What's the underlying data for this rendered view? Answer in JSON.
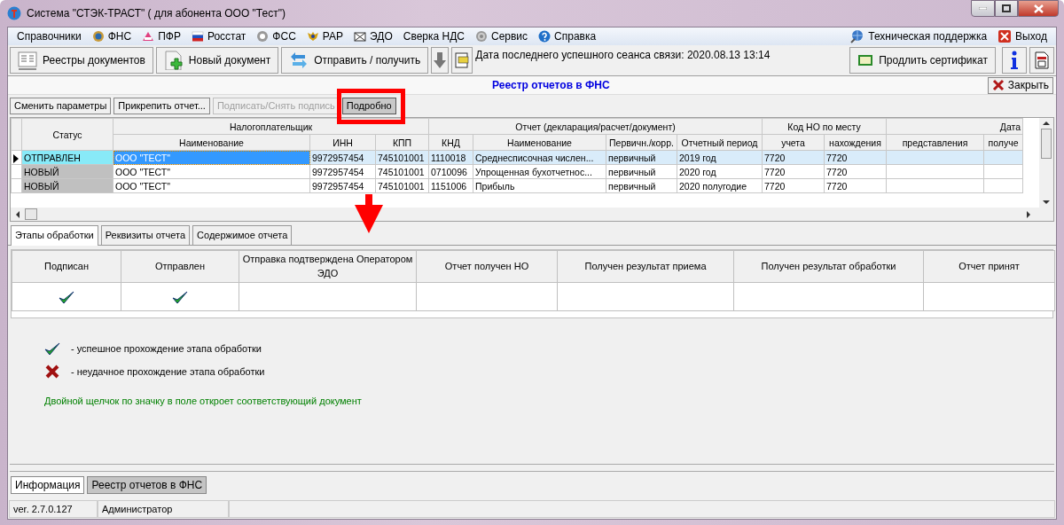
{
  "window": {
    "title": "Система \"СТЭК-ТРАСТ\" ( для абонента ООО \"Тест\")"
  },
  "menu": {
    "left": [
      "Справочники",
      "ФНС",
      "ПФР",
      "Росстат",
      "ФСС",
      "РАР",
      "ЭДО",
      "Сверка НДС",
      "Сервис",
      "Справка"
    ],
    "right": [
      "Техническая поддержка",
      "Выход"
    ]
  },
  "toolbar": {
    "buttons": [
      "Реестры документов",
      "Новый документ",
      "Отправить / получить"
    ],
    "last_session": "Дата последнего успешного сеанса связи: 2020.08.13 13:14",
    "renew_button": "Продлить сертификат"
  },
  "panel": {
    "title": "Реестр отчетов в ФНС",
    "close_button": "Закрыть"
  },
  "actions": [
    {
      "label": "Сменить параметры",
      "disabled": false,
      "pressed": false
    },
    {
      "label": "Прикрепить отчет...",
      "disabled": false,
      "pressed": false
    },
    {
      "label": "Подписать/Снять подпись",
      "disabled": true,
      "pressed": false
    },
    {
      "label": "Подробно",
      "disabled": false,
      "pressed": true
    }
  ],
  "report_grid": {
    "status_column": "Статус",
    "column_groups": [
      {
        "label": "Налогоплательщик",
        "columns": [
          "Наименование",
          "ИНН",
          "КПП"
        ]
      },
      {
        "label": "Отчет (декларация/расчет/документ)",
        "columns": [
          "КНД",
          "Наименование",
          "Первичн./корр.",
          "Отчетный период"
        ]
      },
      {
        "label": "Код НО по месту",
        "columns": [
          "учета",
          "нахождения"
        ]
      },
      {
        "label": "Дата",
        "columns": [
          "представления",
          "получе"
        ]
      }
    ],
    "rows": [
      {
        "selected": true,
        "status": "ОТПРАВЛЕН",
        "color": "#88eaf8",
        "cells": [
          "ООО \"ТЕСТ\"",
          "9972957454",
          "745101001",
          "1110018",
          "Среднесписочная числен...",
          "первичный",
          "2019 год",
          "7720",
          "7720"
        ]
      },
      {
        "selected": false,
        "status": "НОВЫЙ",
        "color": "#c0c0c0",
        "cells": [
          "ООО \"ТЕСТ\"",
          "9972957454",
          "745101001",
          "0710096",
          "Упрощенная бухотчетнос...",
          "первичный",
          "2020 год",
          "7720",
          "7720"
        ]
      },
      {
        "selected": false,
        "status": "НОВЫЙ",
        "color": "#c0c0c0",
        "cells": [
          "ООО \"ТЕСТ\"",
          "9972957454",
          "745101001",
          "1151006",
          "Прибыль",
          "первичный",
          "2020 полугодие",
          "7720",
          "7720"
        ]
      }
    ]
  },
  "tabs": [
    {
      "label": "Этапы обработки",
      "selected": true
    },
    {
      "label": "Реквизиты отчета",
      "selected": false
    },
    {
      "label": "Содержимое отчета",
      "selected": false
    }
  ],
  "stages": [
    {
      "label": "Подписан",
      "done": true
    },
    {
      "label": "Отправлен",
      "done": true
    },
    {
      "label": "Отправка подтверждена Оператором ЭДО",
      "done": false
    },
    {
      "label": "Отчет получен НО",
      "done": false
    },
    {
      "label": "Получен результат приема",
      "done": false
    },
    {
      "label": "Получен результат обработки",
      "done": false
    },
    {
      "label": "Отчет принят",
      "done": false
    }
  ],
  "legend": [
    {
      "kind": "success",
      "text": "-  успешное прохождение этапа обработки"
    },
    {
      "kind": "failure",
      "text": "-  неудачное прохождение этапа обработки"
    }
  ],
  "hint": "Двойной щелчок по значку в поле откроет соответствующий документ",
  "bottom_tabs": [
    {
      "label": "Информация",
      "selected": false
    },
    {
      "label": "Реестр отчетов в ФНС",
      "selected": true
    }
  ],
  "status_bar": [
    "ver. 2.7.0.127",
    "Администратор"
  ]
}
